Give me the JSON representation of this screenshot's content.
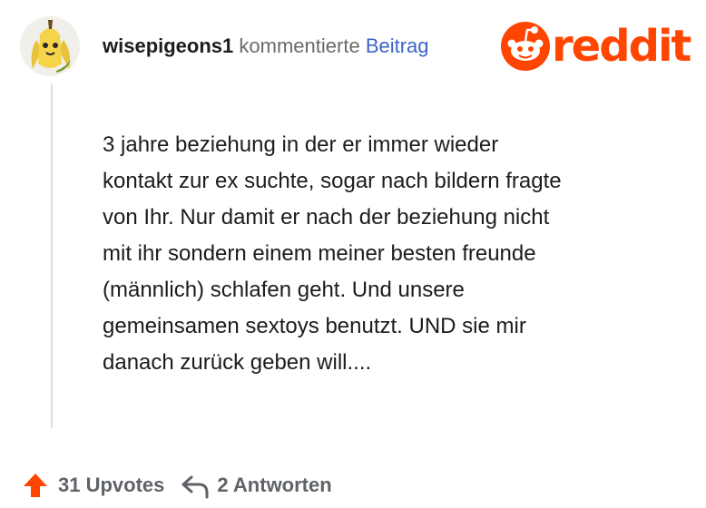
{
  "comment": {
    "username": "wisepigeons1",
    "action_text": "kommentierte",
    "post_link": "Beitrag",
    "body_lines": [
      "3 jahre beziehung in der er immer wieder",
      "kontakt zur ex suchte, sogar nach bildern fragte",
      "von Ihr. Nur damit er nach der beziehung nicht",
      "mit ihr sondern einem meiner besten freunde",
      "(männlich) schlafen geht. Und unsere",
      "gemeinsamen sextoys benutzt. UND sie mir",
      "danach zurück geben will...."
    ]
  },
  "branding": {
    "wordmark": "reddit",
    "brand_color": "#ff4500",
    "icon": "reddit-snoo-icon"
  },
  "footer": {
    "upvotes_label": "31 Upvotes",
    "replies_label": "2 Antworten",
    "upvote_icon": "upvote-arrow-icon",
    "reply_icon": "reply-arrow-icon",
    "upvote_color": "#ff4500"
  }
}
